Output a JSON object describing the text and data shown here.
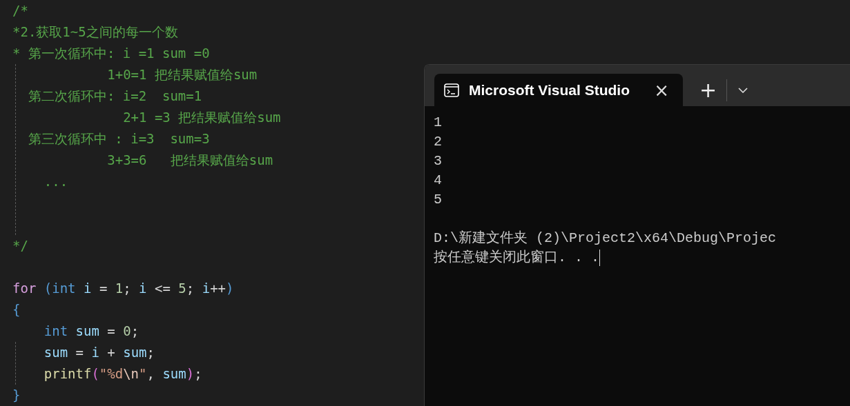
{
  "editor": {
    "comment_lines": [
      {
        "tokens": [
          {
            "kind": "comment",
            "text": "/*"
          }
        ]
      },
      {
        "tokens": [
          {
            "kind": "comment",
            "text": "*2.获取1~5之间的每一个数"
          }
        ]
      },
      {
        "tokens": [
          {
            "kind": "comment",
            "text": "* 第一次循环中: i =1 sum =0"
          }
        ]
      },
      {
        "tokens": [
          {
            "kind": "comment",
            "text": "            1+0=1 把结果赋值给sum"
          }
        ]
      },
      {
        "tokens": [
          {
            "kind": "comment",
            "text": "  第二次循环中: i=2  sum=1"
          }
        ]
      },
      {
        "tokens": [
          {
            "kind": "comment",
            "text": "              2+1 =3 把结果赋值给sum"
          }
        ]
      },
      {
        "tokens": [
          {
            "kind": "comment",
            "text": "  第三次循环中 : i=3  sum=3"
          }
        ]
      },
      {
        "tokens": [
          {
            "kind": "comment",
            "text": "            3+3=6   把结果赋值给sum"
          }
        ]
      },
      {
        "tokens": [
          {
            "kind": "comment",
            "text": "    ..."
          }
        ]
      },
      {
        "tokens": [
          {
            "kind": "comment",
            "text": "*/"
          }
        ]
      }
    ],
    "code_lines": [
      {
        "tokens": [
          {
            "kind": "keyword",
            "text": "for "
          },
          {
            "kind": "paren",
            "text": "("
          },
          {
            "kind": "type",
            "text": "int "
          },
          {
            "kind": "variable",
            "text": "i"
          },
          {
            "kind": "punct",
            "text": " = "
          },
          {
            "kind": "number",
            "text": "1"
          },
          {
            "kind": "punct",
            "text": "; "
          },
          {
            "kind": "variable",
            "text": "i"
          },
          {
            "kind": "punct",
            "text": " <= "
          },
          {
            "kind": "number",
            "text": "5"
          },
          {
            "kind": "punct",
            "text": "; "
          },
          {
            "kind": "variable",
            "text": "i"
          },
          {
            "kind": "punct",
            "text": "++"
          },
          {
            "kind": "paren",
            "text": ")"
          }
        ]
      },
      {
        "tokens": [
          {
            "kind": "paren",
            "text": "{"
          }
        ]
      },
      {
        "tokens": [
          {
            "kind": "type",
            "text": "    int "
          },
          {
            "kind": "variable",
            "text": "sum"
          },
          {
            "kind": "punct",
            "text": " = "
          },
          {
            "kind": "number",
            "text": "0"
          },
          {
            "kind": "punct",
            "text": ";"
          }
        ]
      },
      {
        "tokens": [
          {
            "kind": "variable",
            "text": "    sum"
          },
          {
            "kind": "punct",
            "text": " = "
          },
          {
            "kind": "variable",
            "text": "i"
          },
          {
            "kind": "punct",
            "text": " + "
          },
          {
            "kind": "variable",
            "text": "sum"
          },
          {
            "kind": "punct",
            "text": ";"
          }
        ]
      },
      {
        "tokens": [
          {
            "kind": "function",
            "text": "    printf"
          },
          {
            "kind": "call_paren",
            "text": "("
          },
          {
            "kind": "string",
            "text": "\"%d"
          },
          {
            "kind": "escape",
            "text": "\\n"
          },
          {
            "kind": "string",
            "text": "\""
          },
          {
            "kind": "punct",
            "text": ", "
          },
          {
            "kind": "variable",
            "text": "sum"
          },
          {
            "kind": "call_paren",
            "text": ")"
          },
          {
            "kind": "punct",
            "text": ";"
          }
        ]
      },
      {
        "tokens": [
          {
            "kind": "paren",
            "text": "}"
          }
        ]
      }
    ]
  },
  "terminal": {
    "tab": {
      "title": "Microsoft Visual Studio",
      "close": "×"
    },
    "new_tab": "+",
    "numbers": [
      "1",
      "2",
      "3",
      "4",
      "5"
    ],
    "messages": [
      "D:\\新建文件夹 (2)\\Project2\\x64\\Debug\\Projec",
      "按任意键关闭此窗口. . ."
    ]
  }
}
